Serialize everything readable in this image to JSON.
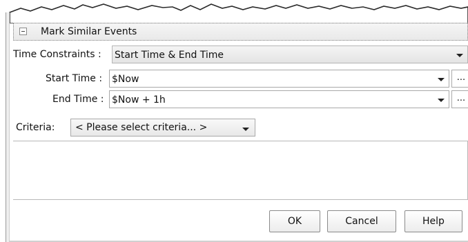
{
  "section": {
    "title": "Mark Similar Events"
  },
  "time_constraints": {
    "label": "Time Constraints :",
    "value": "Start Time & End Time"
  },
  "start_time": {
    "label": "Start Time :",
    "value": "$Now",
    "browse": "..."
  },
  "end_time": {
    "label": "End Time :",
    "value": "$Now + 1h",
    "browse": "..."
  },
  "criteria": {
    "label": "Criteria:",
    "value": "< Please select criteria... >"
  },
  "buttons": {
    "ok": "OK",
    "cancel": "Cancel",
    "help": "Help"
  }
}
